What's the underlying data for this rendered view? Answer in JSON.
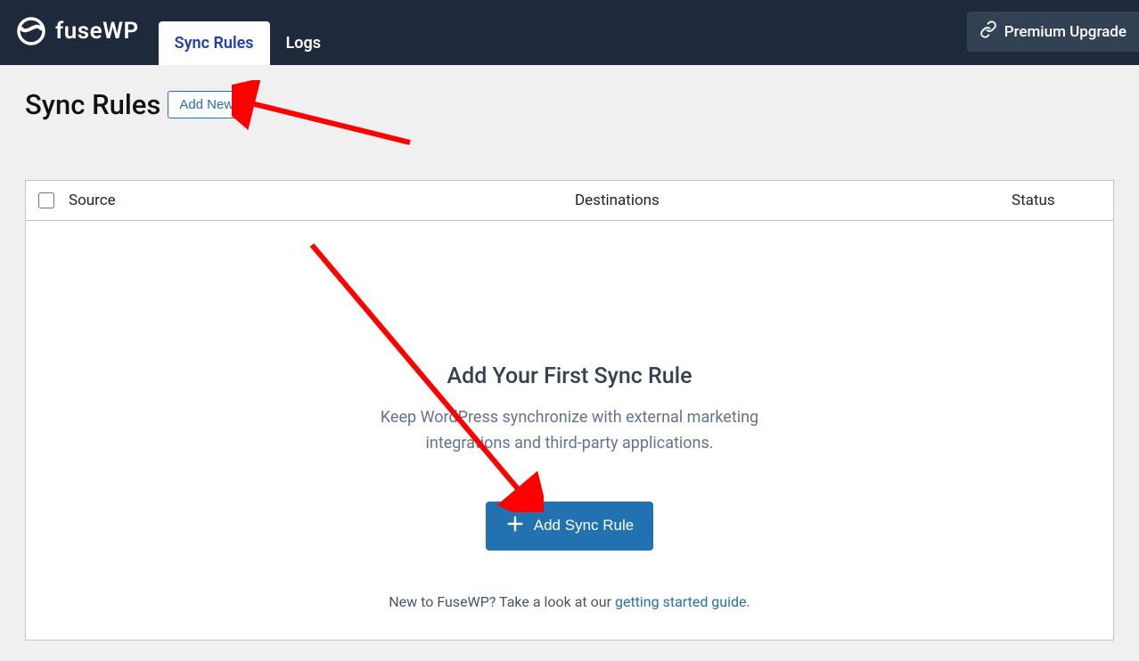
{
  "brand": {
    "name": "fuseWP"
  },
  "tabs": {
    "sync_rules": "Sync Rules",
    "logs": "Logs"
  },
  "premium": {
    "label": "Premium Upgrade"
  },
  "heading": {
    "title": "Sync Rules",
    "add_new": "Add New"
  },
  "table": {
    "columns": {
      "source": "Source",
      "destinations": "Destinations",
      "status": "Status"
    }
  },
  "empty": {
    "title": "Add Your First Sync Rule",
    "subtitle": "Keep WordPress synchronize with external marketing integrations and third-party applications.",
    "button": "Add Sync Rule",
    "note_prefix": "New to FuseWP? Take a look at our ",
    "note_link": "getting started guide",
    "note_suffix": "."
  }
}
